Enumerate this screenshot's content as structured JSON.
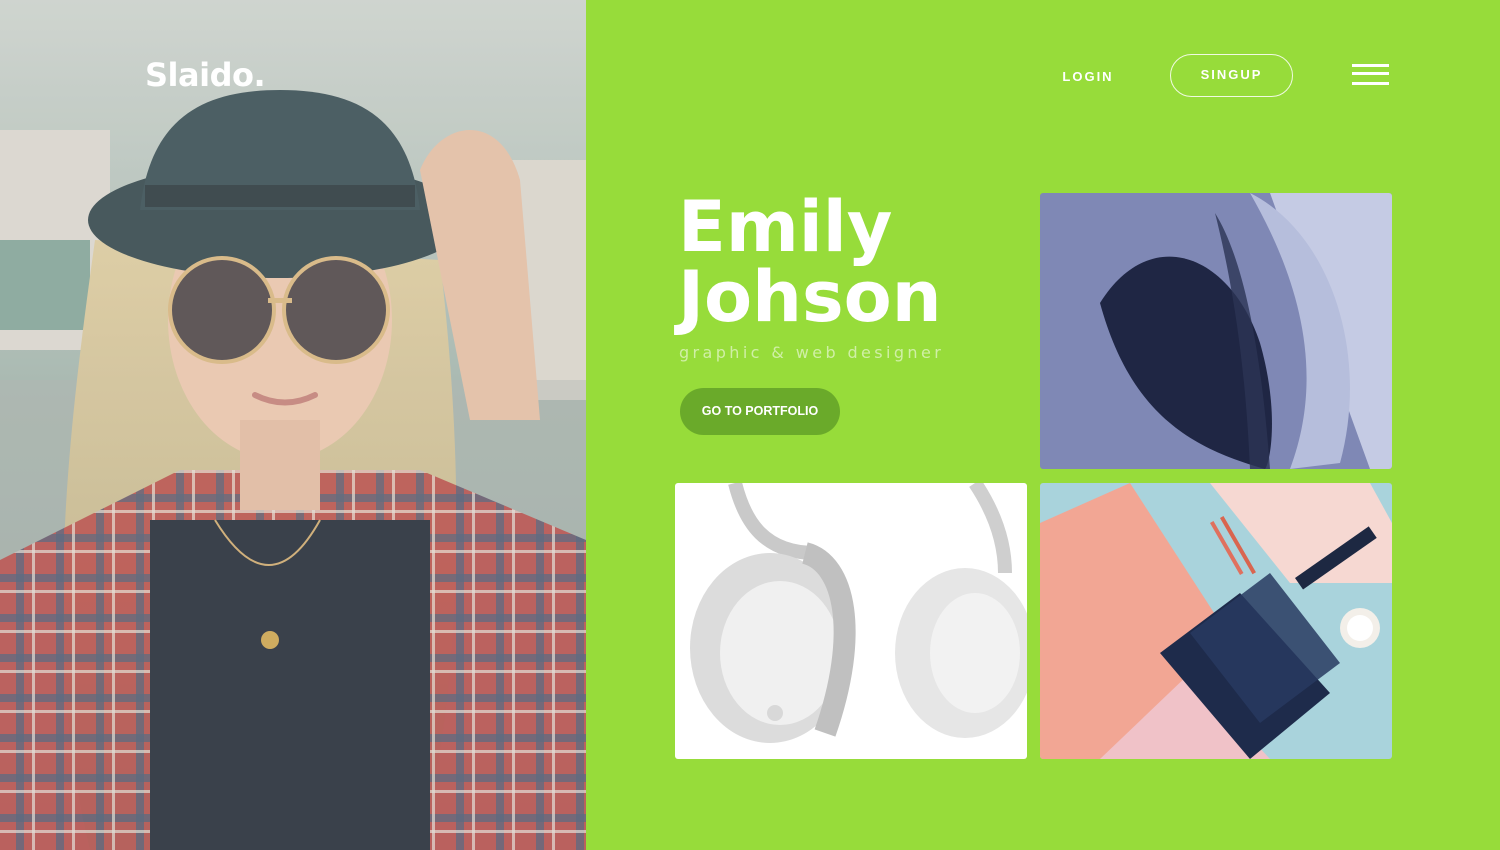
{
  "brand": {
    "logo_text": "Slaido."
  },
  "nav": {
    "login_label": "LOGIN",
    "signup_label": "SINGUP",
    "menu_icon": "hamburger-menu-icon"
  },
  "hero": {
    "name_line1": "Emily",
    "name_line2": "Johson",
    "subtitle": "graphic & web designer",
    "cta_label": "GO TO PORTFOLIO"
  },
  "colors": {
    "accent": "#97dc3a",
    "cta": "#6aaa2a",
    "text": "#ffffff"
  },
  "portfolio_tiles": [
    "abstract-shape-image",
    "headphones-image",
    "stationery-image"
  ]
}
